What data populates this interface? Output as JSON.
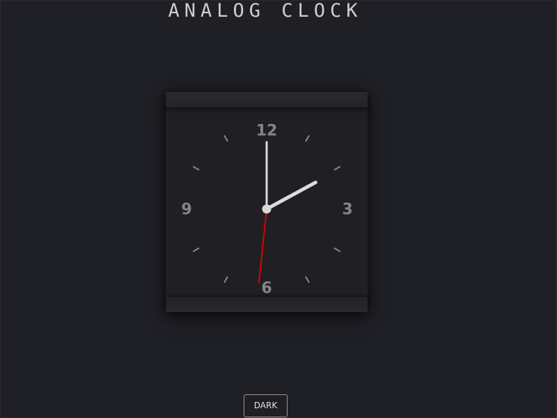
{
  "page": {
    "title": "ANALOG CLOCK"
  },
  "clock": {
    "numerals": {
      "twelve": "12",
      "three": "3",
      "six": "6",
      "nine": "9"
    },
    "time": {
      "hour": 2,
      "minute": 0,
      "second": 31
    },
    "colors": {
      "background": "#1f1f26",
      "hand": "#dcdcdc",
      "second_hand": "#e00000",
      "tick": "#8a8a8a"
    }
  },
  "controls": {
    "mode_button_label": "DARK"
  }
}
